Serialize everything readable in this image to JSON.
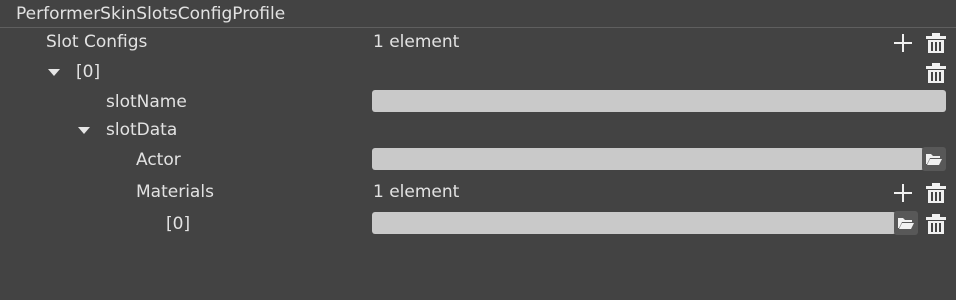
{
  "title": "PerformerSkinSlotsConfigProfile",
  "slot_configs": {
    "label": "Slot Configs",
    "count": "1 element",
    "add_icon": "plus-icon",
    "delete_icon": "trash-icon"
  },
  "item0": {
    "label": "[0]",
    "delete_icon": "trash-icon",
    "slot_name": {
      "label": "slotName",
      "value": ""
    },
    "slot_data": {
      "label": "slotData",
      "actor": {
        "label": "Actor",
        "value": "",
        "browse_icon": "folder-open-icon"
      },
      "materials": {
        "label": "Materials",
        "count": "1 element",
        "add_icon": "plus-icon",
        "delete_icon": "trash-icon",
        "items": [
          {
            "label": "[0]",
            "value": "",
            "browse_icon": "folder-open-icon",
            "delete_icon": "trash-icon"
          }
        ]
      }
    }
  },
  "colors": {
    "background": "#434343",
    "field": "#c9c9c9",
    "text": "#e2e2e2",
    "button": "#585858"
  }
}
